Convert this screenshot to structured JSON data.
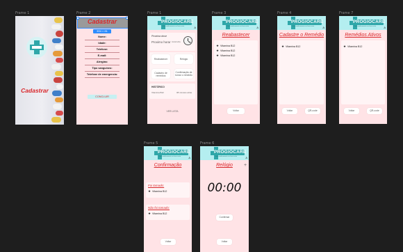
{
  "canvas": {
    "frame_labels": {
      "f1": "Frame 1",
      "f2": "Frame 2",
      "f1b": "Frame 1",
      "f3": "Frame 3",
      "f4": "Frame 4",
      "f7": "Frame 7",
      "f5": "Frame 5",
      "f6": "Frame 6"
    }
  },
  "brand": {
    "name": "PROGIOCARE",
    "tagline": "Seu medicamento na hora certa",
    "corner": "A"
  },
  "splash": {
    "cta": "Cadastrar"
  },
  "register": {
    "title": "Cadastrar",
    "selection_size": "394 × 81",
    "fields": [
      "Nome:",
      "Idade:",
      "Telefone:",
      "E-mail:",
      "Alergias:",
      "Tipo sanguíneo:",
      "Telefone de emergencia:"
    ],
    "submit": "CONCLUIR"
  },
  "home": {
    "next_time_label": "Proxima dose",
    "next_time_hint": "Proximo horar",
    "next_time_note": "Horário/dia",
    "buttons": [
      "Reabastecer",
      "Relógio",
      "Cadastro de remédios",
      "Confirmação de tomar o remédio"
    ],
    "history_title": "HISTÓRICO",
    "history_row": {
      "name": "Vitamina B12",
      "time": "08 minutos atrás"
    },
    "ver_label": "VER LISTA"
  },
  "restock": {
    "title": "Reabastecer",
    "items": [
      "Vitamina B12",
      "Vitamina B12",
      "Vitamina B12"
    ],
    "back": "Voltar"
  },
  "add_med": {
    "title": "Cadastre o Remédio",
    "items": [
      "Vitamina B12"
    ],
    "back": "Voltar",
    "qr": "QR-code"
  },
  "active": {
    "title": "Remédios Ativos",
    "items": [
      "Vitamina B12"
    ],
    "back": "Voltar",
    "qr": "QR-code"
  },
  "confirm": {
    "title": "Confirmação",
    "taken_label": "Foi tomado:",
    "taken_items": [
      "Vitamina B12"
    ],
    "not_taken_label": "Não foi tomado:",
    "not_taken_items": [
      "Vitamina B12"
    ],
    "back": "Voltar"
  },
  "clock": {
    "title": "Relógio",
    "plus": "+",
    "time": "00:00",
    "confirm": "Confirmar",
    "back": "Voltar"
  },
  "colors": {
    "header": "#b4eef0",
    "brand": "#2fa7a9",
    "screen": "#ffe3e6",
    "accent_red": "#d9262a",
    "canvas": "#1e1e1e"
  }
}
